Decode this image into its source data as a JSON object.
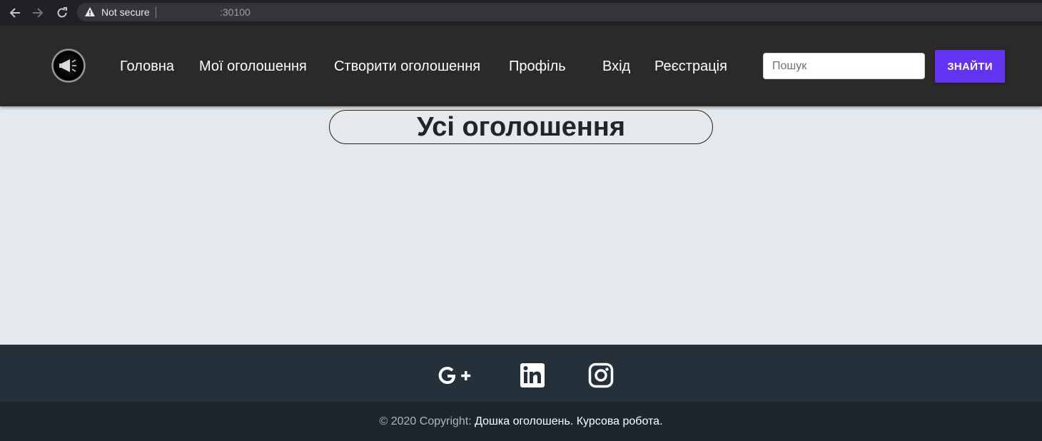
{
  "browser": {
    "security_label": "Not secure",
    "url": ":30100"
  },
  "navbar": {
    "links": [
      "Головна",
      "Мої оголошення",
      "Створити оголошення",
      "Профіль",
      "Вхід",
      "Реєстрація"
    ],
    "search_placeholder": "Пошук",
    "search_button": "ЗНАЙТИ"
  },
  "main": {
    "title": "Усі оголошення"
  },
  "footer": {
    "social_icons": [
      "google-plus-icon",
      "linkedin-icon",
      "instagram-icon"
    ],
    "copyright_prefix": "© 2020 Copyright:",
    "copyright_name": "Дошка оголошень. Курсова робота."
  },
  "colors": {
    "accent": "#6233f0",
    "navbar_bg": "#2b2a29",
    "page_bg": "#e4e9ed",
    "footer_bg": "#24303a"
  }
}
